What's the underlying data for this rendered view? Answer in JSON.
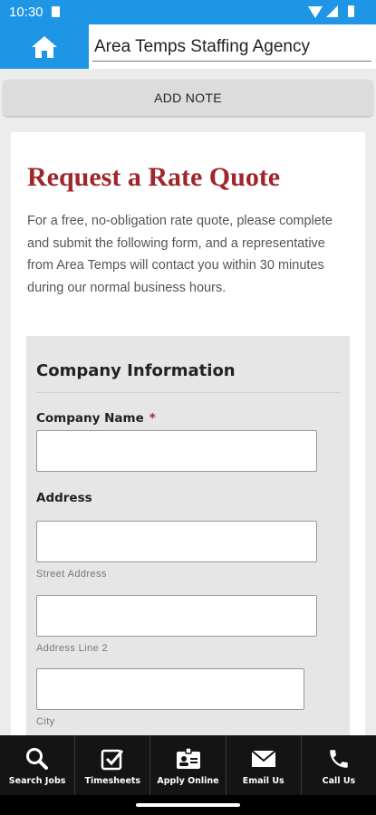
{
  "status_bar": {
    "time": "10:30",
    "icons": [
      "sd-card-icon",
      "wifi-icon",
      "signal-icon",
      "battery-icon"
    ]
  },
  "app_bar": {
    "home_icon": "home-icon",
    "title": "Area Temps Staffing Agency",
    "accent_color": "#1f95e5"
  },
  "add_note": {
    "label": "ADD NOTE"
  },
  "page": {
    "title": "Request a Rate Quote",
    "title_color": "#a0262d",
    "intro": "For a free, no-obligation rate quote, please complete and submit the following form, and a representative from Area Temps will contact you within 30 minutes during our normal business hours."
  },
  "form": {
    "section_title": "Company Information",
    "company_name": {
      "label": "Company Name",
      "required_mark": "*",
      "value": ""
    },
    "address": {
      "label": "Address",
      "street": {
        "sublabel": "Street Address",
        "value": ""
      },
      "line2": {
        "sublabel": "Address Line 2",
        "value": ""
      },
      "city": {
        "sublabel": "City",
        "value": ""
      }
    }
  },
  "bottom_nav": {
    "items": [
      {
        "label": "Search Jobs",
        "icon": "search-icon"
      },
      {
        "label": "Timesheets",
        "icon": "checkbox-icon"
      },
      {
        "label": "Apply Online",
        "icon": "id-card-icon"
      },
      {
        "label": "Email Us",
        "icon": "envelope-icon"
      },
      {
        "label": "Call Us",
        "icon": "phone-icon"
      }
    ]
  }
}
